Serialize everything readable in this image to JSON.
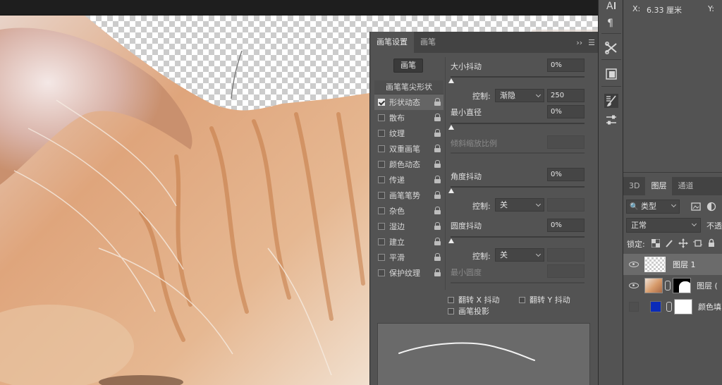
{
  "canvas": {
    "info_x_label": "X:",
    "info_x_value": "6.33 厘米",
    "info_y_label": "Y:"
  },
  "brush_panel": {
    "tabs": [
      "画笔设置",
      "画笔"
    ],
    "brushes_button": "画笔",
    "tip_shape_header": "画笔笔尖形状",
    "options": [
      {
        "label": "形状动态",
        "checked": true,
        "active": true
      },
      {
        "label": "散布",
        "checked": false
      },
      {
        "label": "纹理",
        "checked": false
      },
      {
        "label": "双重画笔",
        "checked": false
      },
      {
        "label": "颜色动态",
        "checked": false
      },
      {
        "label": "传递",
        "checked": false
      },
      {
        "label": "画笔笔势",
        "checked": false
      },
      {
        "label": "杂色",
        "checked": false
      },
      {
        "label": "湿边",
        "checked": false
      },
      {
        "label": "建立",
        "checked": false
      },
      {
        "label": "平滑",
        "checked": false
      },
      {
        "label": "保护纹理",
        "checked": false
      }
    ],
    "size_jitter_label": "大小抖动",
    "size_jitter_value": "0%",
    "control_label": "控制:",
    "control_1_value": "渐隐",
    "control_1_field": "250",
    "min_diameter_label": "最小直径",
    "min_diameter_value": "0%",
    "tilt_scale_label": "倾斜缩放比例",
    "angle_jitter_label": "角度抖动",
    "angle_jitter_value": "0%",
    "control_2_value": "关",
    "roundness_jitter_label": "圆度抖动",
    "roundness_jitter_value": "0%",
    "control_3_value": "关",
    "min_roundness_label": "最小圆度",
    "flip_x_label": "翻转 X 抖动",
    "flip_y_label": "翻转 Y 抖动",
    "brush_projection_label": "画笔投影"
  },
  "layers_panel": {
    "tabs": [
      "3D",
      "图层",
      "通道"
    ],
    "filter_kind": "类型",
    "blend_mode": "正常",
    "opacity_label": "不透",
    "lock_label": "锁定:",
    "layers": [
      {
        "name": "图层 1",
        "visible": true,
        "selected": true
      },
      {
        "name": "图层 (",
        "visible": true,
        "selected": false
      },
      {
        "name": "颜色填",
        "visible": false,
        "selected": false
      }
    ]
  },
  "colors": {
    "panel_bg": "#535353",
    "fill_layer_color": "#0a2bb8"
  }
}
